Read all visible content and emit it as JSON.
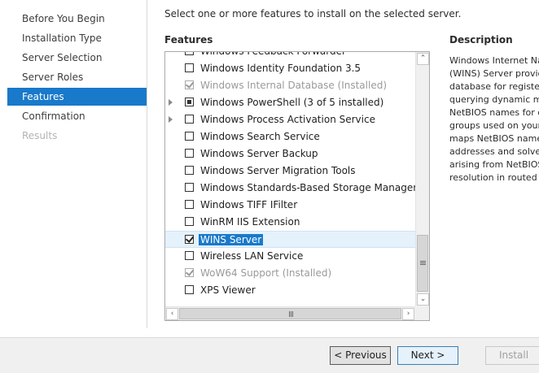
{
  "nav": {
    "items": [
      {
        "label": "Before You Begin",
        "state": "normal"
      },
      {
        "label": "Installation Type",
        "state": "normal"
      },
      {
        "label": "Server Selection",
        "state": "normal"
      },
      {
        "label": "Server Roles",
        "state": "normal"
      },
      {
        "label": "Features",
        "state": "active"
      },
      {
        "label": "Confirmation",
        "state": "normal"
      },
      {
        "label": "Results",
        "state": "disabled"
      }
    ]
  },
  "main": {
    "instruction": "Select one or more features to install on the selected server.",
    "features_label": "Features",
    "description_label": "Description",
    "description_text": "Windows Internet Na\n(WINS) Server provid\ndatabase for register\nquerying dynamic ma\nNetBIOS names for c\ngroups used on your\nmaps NetBIOS name\naddresses and solves\narising from NetBIOS\nresolution in routed e"
  },
  "features": [
    {
      "label": "Windows Feedback Forwarder",
      "check": "unchecked",
      "expander": false,
      "disabled": false,
      "clipped": true
    },
    {
      "label": "Windows Identity Foundation 3.5",
      "check": "unchecked",
      "expander": false,
      "disabled": false
    },
    {
      "label": "Windows Internal Database (Installed)",
      "check": "checked",
      "expander": false,
      "disabled": true
    },
    {
      "label": "Windows PowerShell (3 of 5 installed)",
      "check": "partial",
      "expander": true,
      "disabled": false
    },
    {
      "label": "Windows Process Activation Service",
      "check": "unchecked",
      "expander": true,
      "disabled": false
    },
    {
      "label": "Windows Search Service",
      "check": "unchecked",
      "expander": false,
      "disabled": false
    },
    {
      "label": "Windows Server Backup",
      "check": "unchecked",
      "expander": false,
      "disabled": false
    },
    {
      "label": "Windows Server Migration Tools",
      "check": "unchecked",
      "expander": false,
      "disabled": false
    },
    {
      "label": "Windows Standards-Based Storage Management",
      "check": "unchecked",
      "expander": false,
      "disabled": false
    },
    {
      "label": "Windows TIFF IFilter",
      "check": "unchecked",
      "expander": false,
      "disabled": false
    },
    {
      "label": "WinRM IIS Extension",
      "check": "unchecked",
      "expander": false,
      "disabled": false
    },
    {
      "label": "WINS Server",
      "check": "checked",
      "expander": false,
      "disabled": false,
      "selected": true
    },
    {
      "label": "Wireless LAN Service",
      "check": "unchecked",
      "expander": false,
      "disabled": false
    },
    {
      "label": "WoW64 Support (Installed)",
      "check": "checked",
      "expander": false,
      "disabled": true
    },
    {
      "label": "XPS Viewer",
      "check": "unchecked",
      "expander": false,
      "disabled": false
    }
  ],
  "footer": {
    "previous_label": "< Previous",
    "next_label": "Next >",
    "install_label": "Install"
  },
  "scrollbar": {
    "vertical_position_fraction": 0.9
  },
  "colors": {
    "accent": "#1979ca",
    "selection_bg": "#e5f1fb",
    "disabled_text": "#9a9a9a"
  },
  "icons": {
    "scroll_up": "chevron-up-icon",
    "scroll_down": "chevron-down-icon",
    "scroll_left": "chevron-left-icon",
    "scroll_right": "chevron-right-icon",
    "expander": "triangle-right-icon"
  }
}
